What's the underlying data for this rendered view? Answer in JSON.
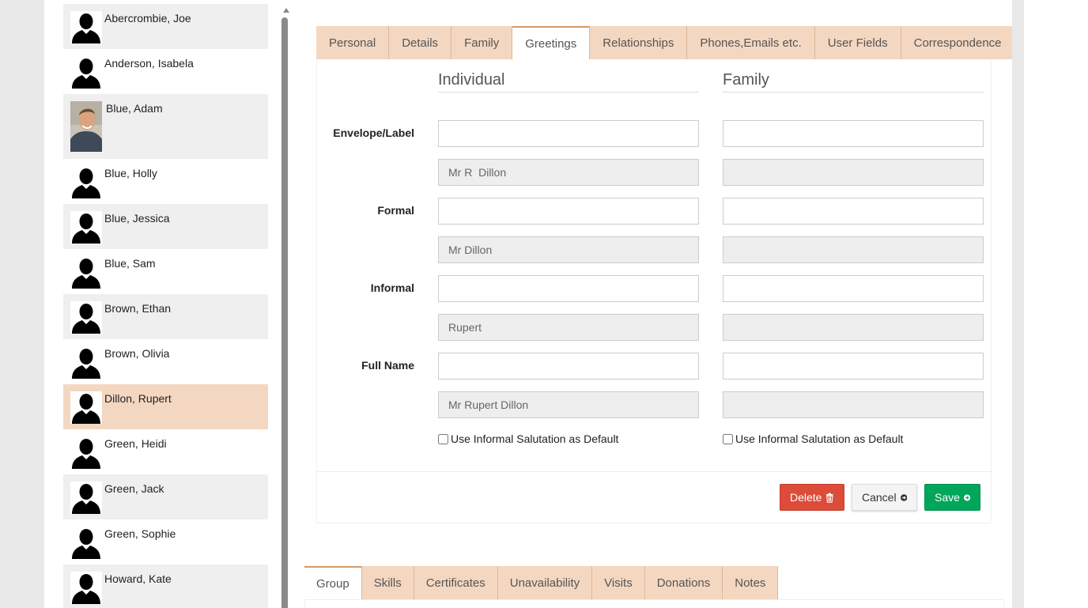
{
  "contacts": [
    {
      "name": "Abercrombie, Joe",
      "photo": false,
      "selected": false
    },
    {
      "name": "Anderson, Isabela",
      "photo": false,
      "selected": false
    },
    {
      "name": "Blue, Adam",
      "photo": true,
      "selected": false
    },
    {
      "name": "Blue, Holly",
      "photo": false,
      "selected": false
    },
    {
      "name": "Blue, Jessica",
      "photo": false,
      "selected": false
    },
    {
      "name": "Blue, Sam",
      "photo": false,
      "selected": false
    },
    {
      "name": "Brown, Ethan",
      "photo": false,
      "selected": false
    },
    {
      "name": "Brown, Olivia",
      "photo": false,
      "selected": false
    },
    {
      "name": "Dillon, Rupert",
      "photo": false,
      "selected": true
    },
    {
      "name": "Green, Heidi",
      "photo": false,
      "selected": false
    },
    {
      "name": "Green, Jack",
      "photo": false,
      "selected": false
    },
    {
      "name": "Green, Sophie",
      "photo": false,
      "selected": false
    },
    {
      "name": "Howard, Kate",
      "photo": false,
      "selected": false
    }
  ],
  "top_tabs": {
    "personal": "Personal",
    "details": "Details",
    "family": "Family",
    "greetings": "Greetings",
    "relationships": "Relationships",
    "phones": "Phones,Emails etc.",
    "user_fields": "User Fields",
    "correspondence": "Correspondence",
    "active": "Greetings"
  },
  "columns": {
    "individual": "Individual",
    "family": "Family"
  },
  "rows": {
    "envelope": "Envelope/Label",
    "formal": "Formal",
    "informal": "Informal",
    "full_name": "Full Name"
  },
  "fields": {
    "envelope_individual": "",
    "envelope_individual_default": "Mr R  Dillon",
    "envelope_family": "",
    "envelope_family_default": "",
    "formal_individual": "",
    "formal_individual_default": "Mr Dillon",
    "formal_family": "",
    "formal_family_default": "",
    "informal_individual": "",
    "informal_individual_default": "Rupert",
    "informal_family": "",
    "informal_family_default": "",
    "fullname_individual": "",
    "fullname_individual_default": "Mr Rupert Dillon",
    "fullname_family": "",
    "fullname_family_default": ""
  },
  "checkboxes": {
    "individual_label": "Use Informal Salutation as Default",
    "individual_checked": false,
    "family_label": "Use Informal Salutation as Default",
    "family_checked": false
  },
  "buttons": {
    "delete": "Delete",
    "cancel": "Cancel",
    "save": "Save"
  },
  "bottom_tabs": {
    "group": "Group",
    "skills": "Skills",
    "certificates": "Certificates",
    "unavailability": "Unavailability",
    "visits": "Visits",
    "donations": "Donations",
    "notes": "Notes",
    "active": "Group"
  },
  "colors": {
    "tab_bg": "#f4d7c1",
    "tab_accent": "#d59a66",
    "selected_row": "#f4d7c1",
    "delete": "#dd4b39",
    "save": "#00a65a"
  },
  "icons": {
    "avatar": "person-silhouette-icon",
    "delete": "trash-icon",
    "cancel": "arrow-circle-right-icon",
    "save": "arrow-circle-right-icon"
  }
}
